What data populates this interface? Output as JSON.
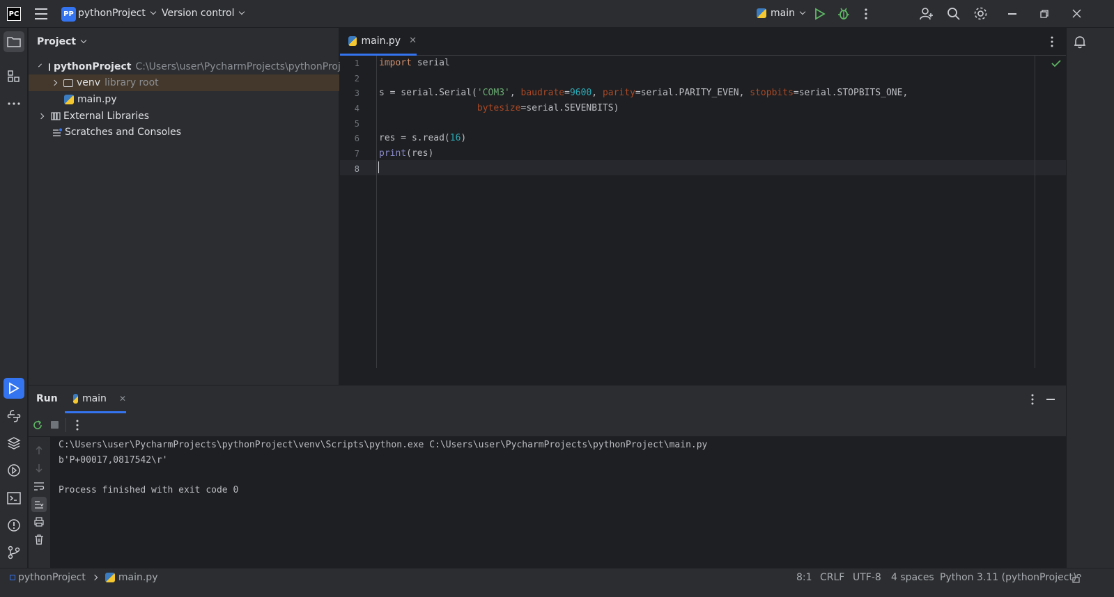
{
  "titlebar": {
    "logo_text": "PC",
    "project_badge": "PP",
    "project_name": "pythonProject",
    "vcs_label": "Version control",
    "run_config": "main"
  },
  "project_panel": {
    "header": "Project",
    "tree": [
      {
        "label": "pythonProject",
        "hint": "C:\\Users\\user\\PycharmProjects\\pythonProject"
      },
      {
        "label": "venv",
        "hint": "library root"
      },
      {
        "label": "main.py",
        "hint": ""
      },
      {
        "label": "External Libraries",
        "hint": ""
      },
      {
        "label": "Scratches and Consoles",
        "hint": ""
      }
    ]
  },
  "editor": {
    "tab_label": "main.py",
    "line_numbers": [
      "1",
      "2",
      "3",
      "4",
      "5",
      "6",
      "7",
      "8"
    ],
    "code": {
      "l1_kw": "import",
      "l1_rest": " serial",
      "l3_a": "s = serial.Serial(",
      "l3_str": "'COM3'",
      "l3_b": ", ",
      "l3_p1": "baudrate",
      "l3_eq1": "=",
      "l3_n1": "9600",
      "l3_c": ", ",
      "l3_p2": "parity",
      "l3_d": "=serial.PARITY_EVEN, ",
      "l3_p3": "stopbits",
      "l3_e": "=serial.STOPBITS_ONE,",
      "l4_indent": "                  ",
      "l4_p": "bytesize",
      "l4_rest": "=serial.SEVENBITS)",
      "l6_a": "res = s.read(",
      "l6_n": "16",
      "l6_b": ")",
      "l7_fn": "print",
      "l7_rest": "(res)"
    }
  },
  "run_panel": {
    "title": "Run",
    "tab_label": "main",
    "console": [
      "C:\\Users\\user\\PycharmProjects\\pythonProject\\venv\\Scripts\\python.exe C:\\Users\\user\\PycharmProjects\\pythonProject\\main.py",
      "b'P+00017,0817542\\r'",
      "",
      "Process finished with exit code 0"
    ]
  },
  "statusbar": {
    "breadcrumb_project": "pythonProject",
    "breadcrumb_file": "main.py",
    "position": "8:1",
    "line_ending": "CRLF",
    "encoding": "UTF-8",
    "indent": "4 spaces",
    "interpreter": "Python 3.11 (pythonProject)"
  },
  "colors": {
    "accent": "#3574f0",
    "background": "#1e1f22",
    "panel": "#2b2d30",
    "keyword": "#cf8e6d",
    "string": "#6aab73",
    "number": "#2aacb8",
    "param": "#aa4926"
  }
}
